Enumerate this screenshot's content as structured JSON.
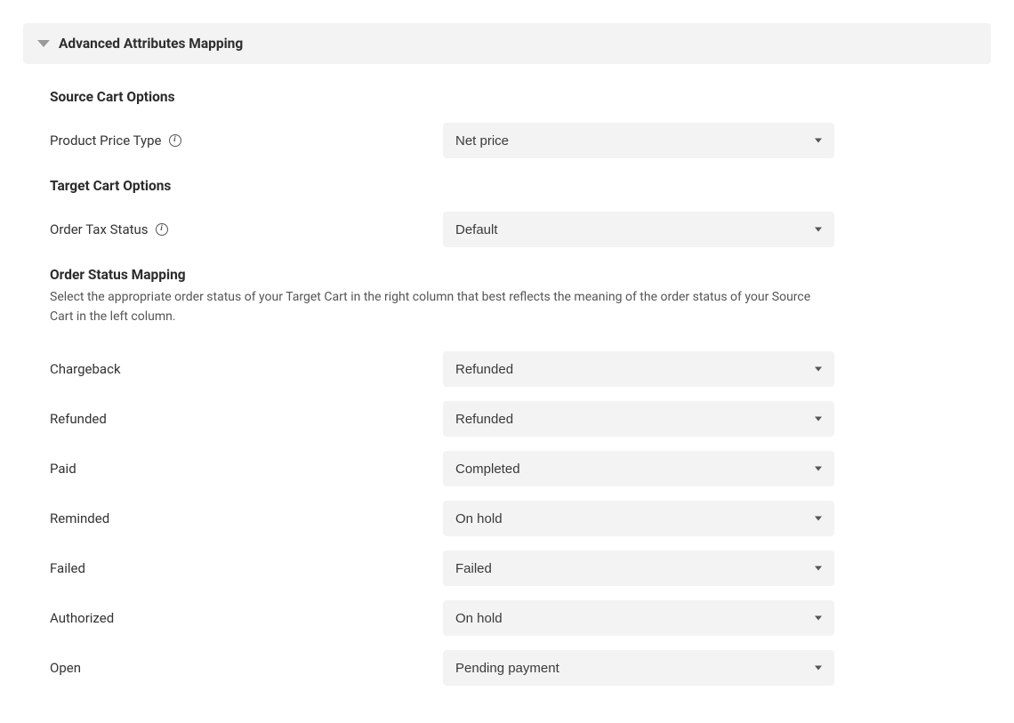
{
  "accordion": {
    "title": "Advanced Attributes Mapping"
  },
  "source_section": {
    "title": "Source Cart Options",
    "product_price_type": {
      "label": "Product Price Type",
      "value": "Net price"
    }
  },
  "target_section": {
    "title": "Target Cart Options",
    "order_tax_status": {
      "label": "Order Tax Status",
      "value": "Default"
    }
  },
  "mapping_section": {
    "title": "Order Status Mapping",
    "description": "Select the appropriate order status of your Target Cart in the right column that best reflects the meaning of the order status of your Source Cart in the left column.",
    "rows": [
      {
        "source": "Chargeback",
        "target": "Refunded"
      },
      {
        "source": "Refunded",
        "target": "Refunded"
      },
      {
        "source": "Paid",
        "target": "Completed"
      },
      {
        "source": "Reminded",
        "target": "On hold"
      },
      {
        "source": "Failed",
        "target": "Failed"
      },
      {
        "source": "Authorized",
        "target": "On hold"
      },
      {
        "source": "Open",
        "target": "Pending payment"
      }
    ]
  }
}
